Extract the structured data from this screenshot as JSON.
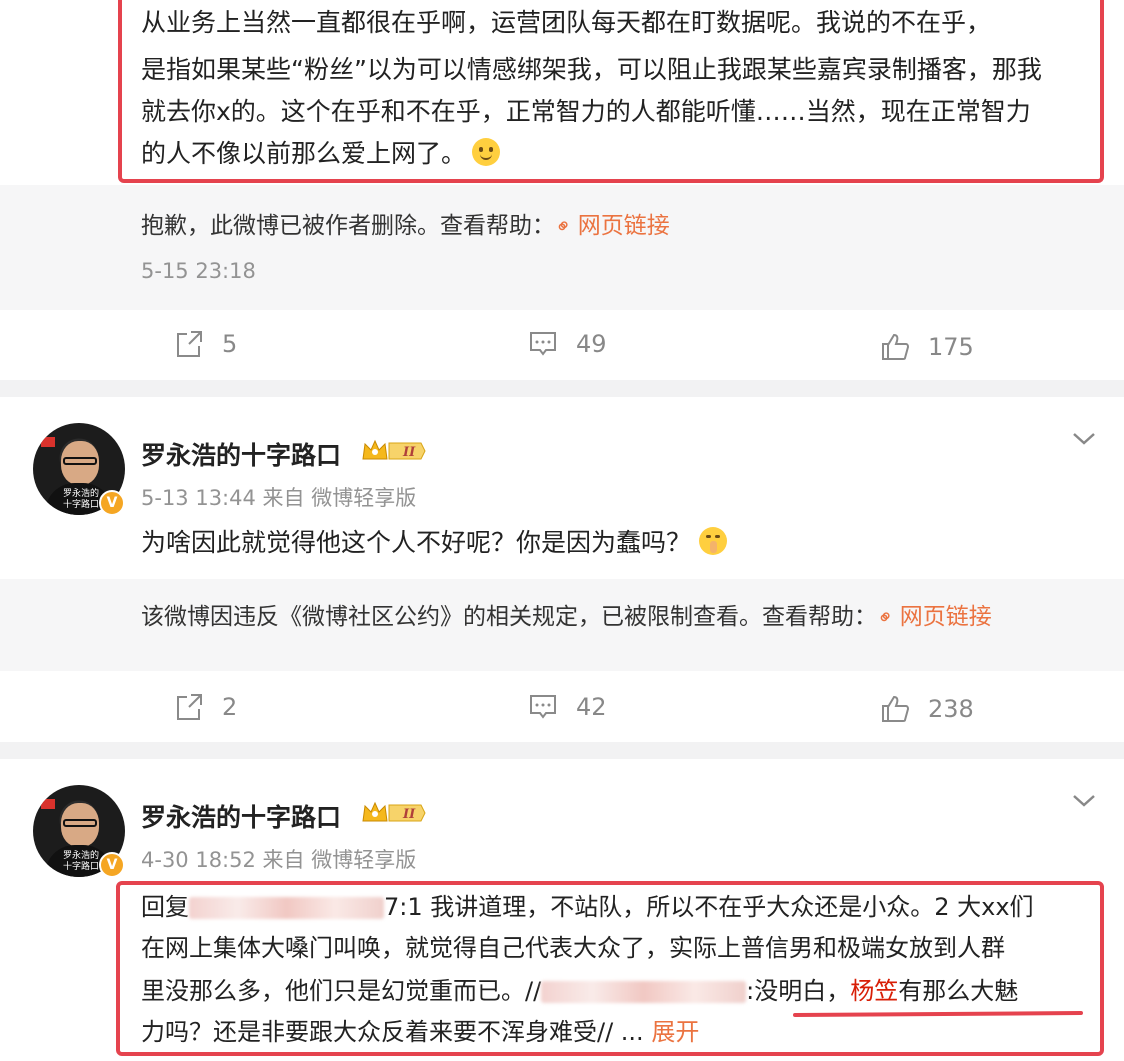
{
  "post0": {
    "lines": [
      "从业务上当然一直都很在乎啊，运营团队每天都在盯数据呢。我说的不在乎，",
      "是指如果某些“粉丝”以为可以情感绑架我，可以阻止我跟某些嘉宾录制播客，那我",
      "就去你x的。这个在乎和不在乎，正常智力的人都能听懂……当然，现在正常智力",
      "的人不像以前那么爱上网了。"
    ],
    "repost_deleted_text": "抱歉，此微博已被作者删除。查看帮助：",
    "repost_link": "网页链接",
    "repost_time": "5-15 23:18",
    "actions": {
      "share": "5",
      "comment": "49",
      "like": "175"
    }
  },
  "post1": {
    "username": "罗永浩的十字路口",
    "meta": "5-13 13:44  来自 微博轻享版",
    "text_a": "为啥因此就",
    "text_b": "觉得他这个人不好呢？你是因为蠢吗？",
    "restricted_text": "该微博因违反《微博社区公约》的相关规定，已被限制查看。查看帮助：",
    "restricted_link": "网页链接",
    "actions": {
      "share": "2",
      "comment": "42",
      "like": "238"
    }
  },
  "post2": {
    "username": "罗永浩的十字路口",
    "meta": "4-30 18:52  来自 微博轻享版",
    "line1_a": "回复",
    "line1_b": "7:1 我讲道理，不站队，所以不在乎大众还是小众。2 大xx们",
    "line2": "在网上集体大嗓门叫唤，就觉得自己代表大众了，实际上普信男和极端女放到人群",
    "line3_a": "里没那么多，他们只是幻觉重而已。//",
    "line3_b": ":没明白，",
    "line3_name": "杨笠",
    "line3_c": "有那么大魅",
    "line4": "力吗？还是非要跟大众反着来要不浑身难受// ...",
    "expand": "展开"
  },
  "avatar_caption": "罗永浩的十字路口",
  "vip_badge": "V",
  "level_badge": "II",
  "icons": [
    "share-icon",
    "comment-icon",
    "like-icon",
    "link-icon",
    "chevron-down-icon",
    "crown-icon",
    "smile-emoji",
    "shush-emoji"
  ],
  "colors": {
    "highlight_box": "#e5434e",
    "link": "#eb7340",
    "meta": "#939393",
    "repost_bg": "#f6f6f7"
  }
}
